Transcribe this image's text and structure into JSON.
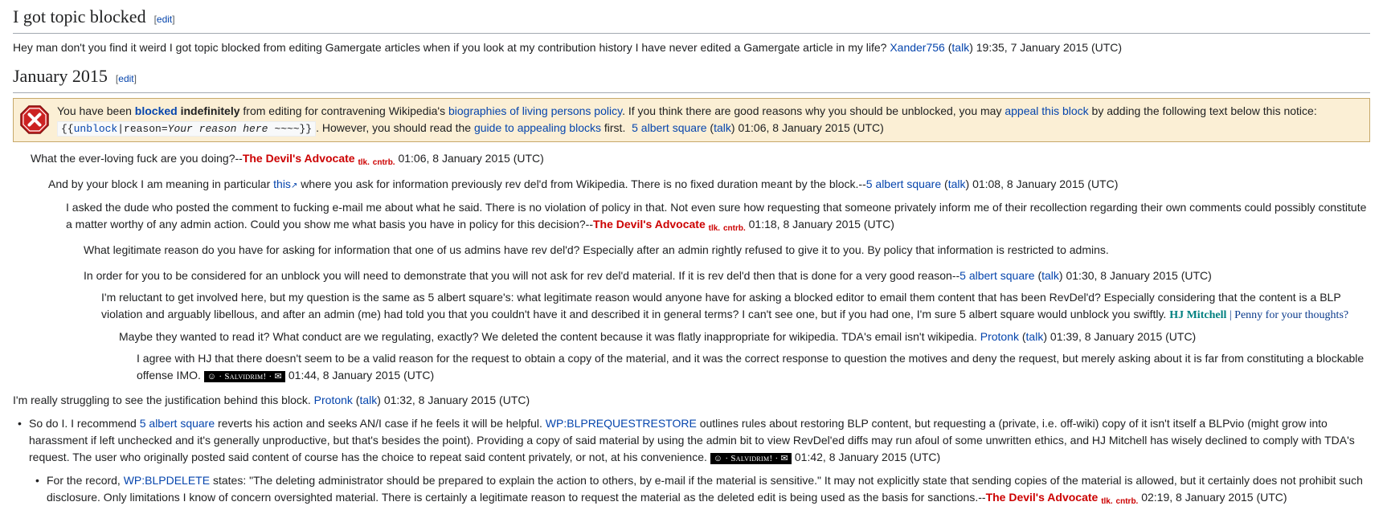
{
  "section1": {
    "title": "I got topic blocked",
    "edit_label": "edit",
    "body": "Hey man don't you find it weird I got topic blocked from editing Gamergate articles when if you look at my contribution history I have never edited a Gamergate article in my life?",
    "user": "Xander756",
    "talk": "talk",
    "time": "19:35, 7 January 2015 (UTC)"
  },
  "section2": {
    "title": "January 2015",
    "edit_label": "edit"
  },
  "notice": {
    "t1": "You have been ",
    "blocked": "blocked",
    "t2": " indefinitely",
    "t3": " from editing for contravening Wikipedia's ",
    "blp_link": "biographies of living persons policy",
    "t4": ". If you think there are good reasons why you should be unblocked, you may ",
    "appeal_link": "appeal this block",
    "t5": " by adding the following text below this notice:",
    "tpl_open": "{{",
    "tpl_name": "unblock",
    "tpl_mid": "|reason=",
    "tpl_reason": "Your reason here ~~~~",
    "tpl_close": "}}",
    "t6": ". However, you should read the ",
    "guide_link": "guide to appealing blocks",
    "t7": " first.",
    "sig_user": "5 albert square",
    "sig_talk": "talk",
    "sig_time": "01:06, 8 January 2015 (UTC)"
  },
  "sig": {
    "tda": "The Devil's Advocate",
    "tda_tlk": "tlk.",
    "tda_cntrb": "cntrb.",
    "albert": "5 albert square",
    "protonk": "Protonk",
    "talk": "talk",
    "salv": "☺ · Salvidrim! · ✉",
    "hj": "HJ Mitchell",
    "hj_sep": " | ",
    "hj_penny": "Penny for your thoughts?"
  },
  "comments": {
    "c1_text": "What the ever-loving fuck are you doing?--",
    "c1_time": "01:06, 8 January 2015 (UTC)",
    "c2_a": "And by your block I am meaning in particular ",
    "c2_link": "this",
    "c2_b": " where you ask for information previously rev del'd from Wikipedia. There is no fixed duration meant by the block.--",
    "c2_time": "01:08, 8 January 2015 (UTC)",
    "c3_text": "I asked the dude who posted the comment to fucking e-mail me about what he said. There is no violation of policy in that. Not even sure how requesting that someone privately inform me of their recollection regarding their own comments could possibly constitute a matter worthy of any admin action. Could you show me what basis you have in policy for this decision?--",
    "c3_time": "01:18, 8 January 2015 (UTC)",
    "c4_text": "What legitimate reason do you have for asking for information that one of us admins have rev del'd? Especially after an admin rightly refused to give it to you. By policy that information is restricted to admins.",
    "c5_text": "In order for you to be considered for an unblock you will need to demonstrate that you will not ask for rev del'd material. If it is rev del'd then that is done for a very good reason--",
    "c5_time": "01:30, 8 January 2015 (UTC)",
    "c6_text": "I'm reluctant to get involved here, but my question is the same as 5 albert square's: what legitimate reason would anyone have for asking a blocked editor to email them content that has been RevDel'd? Especially considering that the content is a BLP violation and arguably libellous, and after an admin (me) had told you that you couldn't have it and described it in general terms? I can't see one, but if you had one, I'm sure 5 albert square would unblock you swiftly. ",
    "c7_text": "Maybe they wanted to read it? What conduct are we regulating, exactly? We deleted the content because it was flatly inappropriate for wikipedia. TDA's email isn't wikipedia. ",
    "c7_time": "01:39, 8 January 2015 (UTC)",
    "c8_text": "I agree with HJ that there doesn't seem to be a valid reason for the request to obtain a copy of the material, and it was the correct response to question the motives and deny the request, but merely asking about it is far from constituting a blockable offense IMO. ",
    "c8_time": "01:44, 8 January 2015 (UTC)",
    "c9_text": "I'm really struggling to see the justification behind this block. ",
    "c9_time": "01:32, 8 January 2015 (UTC)",
    "c10_a": "So do I. I recommend ",
    "c10_b": " reverts his action and seeks AN/I case if he feels it will be helpful. ",
    "c10_link": "WP:BLPREQUESTRESTORE",
    "c10_c": " outlines rules about restoring BLP content, but requesting a (private, i.e. off-wiki) copy of it isn't itself a BLPvio (might grow into harassment if left unchecked and it's generally unproductive, but that's besides the point). Providing a copy of said material by using the admin bit to view RevDel'ed diffs may run afoul of some unwritten ethics, and HJ Mitchell has wisely declined to comply with TDA's request. The user who originally posted said content of course has the choice to repeat said content privately, or not, at his convenience. ",
    "c10_time": "01:42, 8 January 2015 (UTC)",
    "c11_a": "For the record, ",
    "c11_link": "WP:BLPDELETE",
    "c11_b": " states: \"The deleting administrator should be prepared to explain the action to others, by e-mail if the material is sensitive.\" It may not explicitly state that sending copies of the material is allowed, but it certainly does not prohibit such disclosure. Only limitations I know of concern oversighted material. There is certainly a legitimate reason to request the material as the deleted edit is being used as the basis for sanctions.--",
    "c11_time": "02:19, 8 January 2015 (UTC)"
  }
}
